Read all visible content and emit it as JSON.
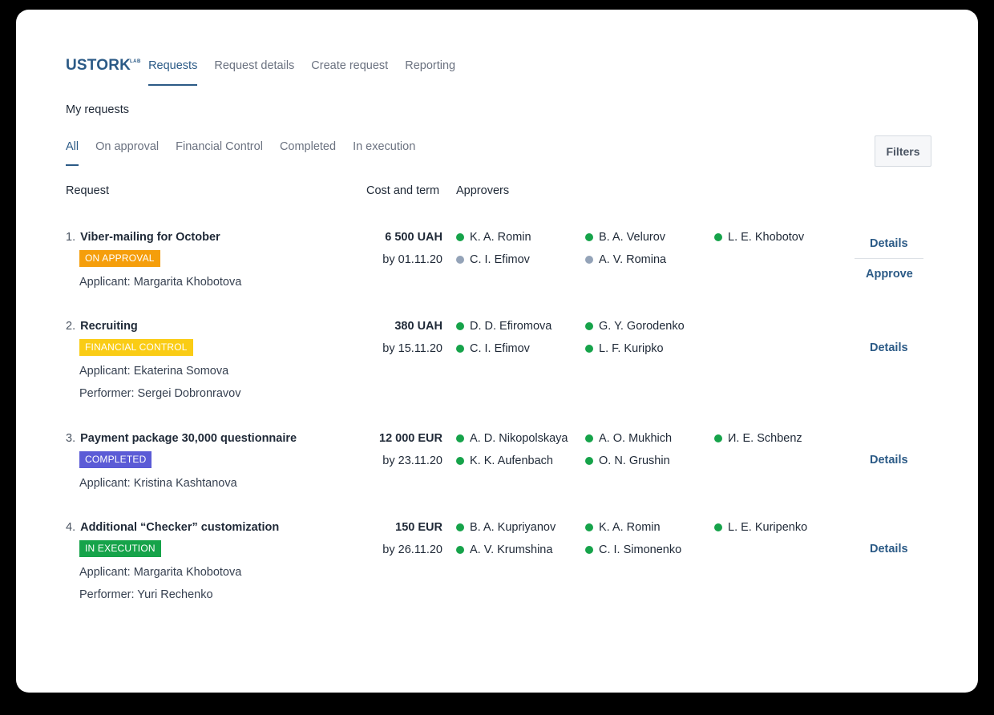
{
  "brand": {
    "name": "USTORK",
    "sup": "LAB"
  },
  "nav": {
    "tabs": [
      "Requests",
      "Request details",
      "Create request",
      "Reporting"
    ],
    "active": 0
  },
  "page_title": "My requests",
  "filter_tabs": [
    "All",
    "On approval",
    "Financial Control",
    "Completed",
    "In execution"
  ],
  "filters_button": "Filters",
  "columns": {
    "request": "Request",
    "cost": "Cost and term",
    "approvers": "Approvers"
  },
  "colors": {
    "accent": "#2b5a86",
    "approved": "#16a34a",
    "pending": "#94a3b8"
  },
  "requests": [
    {
      "num": "1.",
      "title": "Viber-mailing for October",
      "status": {
        "label": "ON APPROVAL",
        "color": "#f59e0b"
      },
      "details": [
        "Applicant: Margarita Khobotova"
      ],
      "cost": "6 500 UAH",
      "term": "by 01.11.20",
      "approvers": [
        [
          {
            "name": "K. A. Romin",
            "state": "approved"
          },
          {
            "name": "B. A. Velurov",
            "state": "approved"
          },
          {
            "name": "L. E. Khobotov",
            "state": "approved"
          }
        ],
        [
          {
            "name": "C. I. Efimov",
            "state": "pending"
          },
          {
            "name": "A. V. Romina",
            "state": "pending"
          }
        ]
      ],
      "actions": [
        "Details",
        "Approve"
      ]
    },
    {
      "num": "2.",
      "title": "Recruiting",
      "status": {
        "label": "FINANCIAL CONTROL",
        "color": "#facc15"
      },
      "details": [
        "Applicant: Ekaterina Somova",
        "Performer: Sergei Dobronravov"
      ],
      "cost": "380 UAH",
      "term": "by 15.11.20",
      "approvers": [
        [
          {
            "name": "D. D. Efiromova",
            "state": "approved"
          },
          {
            "name": "G. Y. Gorodenko",
            "state": "approved"
          }
        ],
        [
          {
            "name": "C. I. Efimov",
            "state": "approved"
          },
          {
            "name": "L. F. Kuripko",
            "state": "approved"
          }
        ]
      ],
      "actions": [
        "Details"
      ]
    },
    {
      "num": "3.",
      "title": "Payment package 30,000 questionnaire",
      "status": {
        "label": "COMPLETED",
        "color": "#5b5bd6"
      },
      "details": [
        "Applicant: Kristina Kashtanova"
      ],
      "cost": "12 000 EUR",
      "term": "by 23.11.20",
      "approvers": [
        [
          {
            "name": "A. D. Nikopolskaya",
            "state": "approved"
          },
          {
            "name": "A. O. Mukhich",
            "state": "approved"
          },
          {
            "name": "И. E. Schbenz",
            "state": "approved"
          }
        ],
        [
          {
            "name": "K. K. Aufenbach",
            "state": "approved"
          },
          {
            "name": "O. N. Grushin",
            "state": "approved"
          }
        ]
      ],
      "actions": [
        "Details"
      ]
    },
    {
      "num": "4.",
      "title": "Additional “Checker” customization",
      "status": {
        "label": "IN EXECUTION",
        "color": "#16a34a"
      },
      "details": [
        "Applicant: Margarita Khobotova",
        "Performer: Yuri Rechenko"
      ],
      "cost": "150 EUR",
      "term": "by 26.11.20",
      "approvers": [
        [
          {
            "name": "B. A. Kupriyanov",
            "state": "approved"
          },
          {
            "name": "K. A. Romin",
            "state": "approved"
          },
          {
            "name": "L. E. Kuripenko",
            "state": "approved"
          }
        ],
        [
          {
            "name": "A. V. Krumshina",
            "state": "approved"
          },
          {
            "name": "C. I. Simonenko",
            "state": "approved"
          }
        ]
      ],
      "actions": [
        "Details"
      ]
    }
  ]
}
